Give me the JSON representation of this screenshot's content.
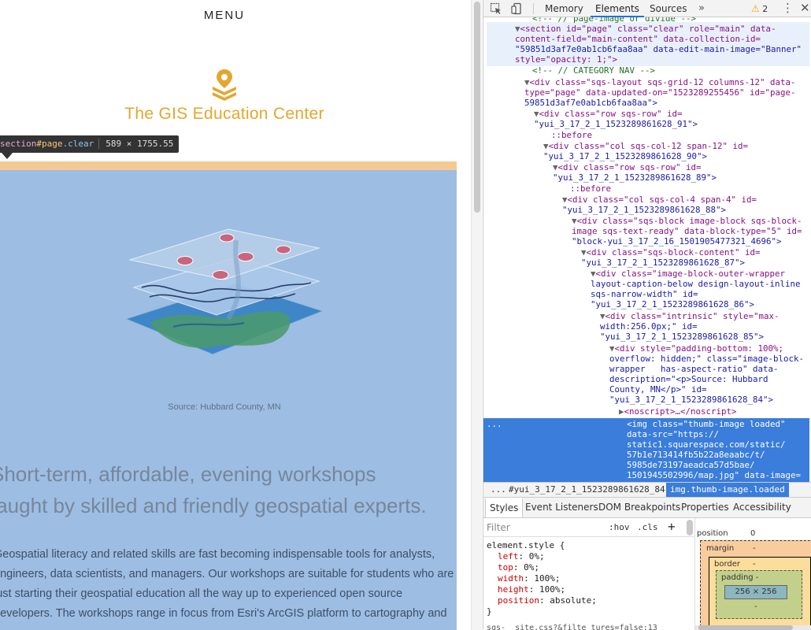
{
  "site": {
    "menu_label": "MENU",
    "title": "The GIS Education Center",
    "caption": "Source: Hubbard County, MN",
    "lead_lines": [
      "Short-term, affordable, evening workshops",
      "taught by skilled and friendly geospatial experts."
    ],
    "body_lines": [
      "Geospatial literacy and related skills are fast becoming indispensable tools for analysts,",
      "engineers, data scientists, and managers. Our workshops are suitable for students who are",
      "just starting their geospatial education all the way up to experienced open source",
      "developers. The workshops range in focus from Esri's ArcGIS platform to cartography and"
    ],
    "brand_color": "#e3a72f",
    "highlight_color": "#9dbde3"
  },
  "inspect_tooltip": {
    "tag": "section",
    "id": "#page",
    "classes": ".clear",
    "dimensions": "589 × 1755.55"
  },
  "devtools": {
    "tabs": [
      "Memory",
      "Elements",
      "Sources"
    ],
    "active_tab": "Elements",
    "more_tabs": "»",
    "warning_count": "2",
    "close": "✕",
    "dom_lines": [
      "<!-- // page-image or divide -->",
      "<section id=\"page\" class=\"clear\" role=\"main\" data-",
      "content-field=\"main-content\" data-collection-id=",
      "\"59851d3af7e0ab1cb6faa8aa\" data-edit-main-image=\"Banner\"",
      "style=\"opacity: 1;\">",
      "<!-- // CATEGORY NAV -->",
      "<div class=\"sqs-layout sqs-grid-12 columns-12\" data-",
      "type=\"page\" data-updated-on=\"1523289255456\" id=\"page-",
      "59851d3af7e0ab1cb6faa8aa\">",
      "<div class=\"row sqs-row\" id=",
      "\"yui_3_17_2_1_1523289861628_91\">",
      "::before",
      "<div class=\"col sqs-col-12 span-12\" id=",
      "\"yui_3_17_2_1_1523289861628_90\">",
      "<div class=\"row sqs-row\" id=",
      "\"yui_3_17_2_1_1523289861628_89\">",
      "::before",
      "<div class=\"col sqs-col-4 span-4\" id=",
      "\"yui_3_17_2_1_1523289861628_88\">",
      "<div class=\"sqs-block image-block sqs-block-",
      "image sqs-text-ready\" data-block-type=\"5\" id=",
      "\"block-yui_3_17_2_16_1501905477321_4696\">",
      "<div class=\"sqs-block-content\" id=",
      "\"yui_3_17_2_1_1523289861628_87\">",
      "<div class=\"image-block-outer-wrapper",
      "layout-caption-below design-layout-inline",
      "sqs-narrow-width\" id=",
      "\"yui_3_17_2_1_1523289861628_86\">",
      "<div class=\"intrinsic\" style=\"max-",
      "width:256.0px;\" id=",
      "\"yui_3_17_2_1_1523289861628_85\">",
      "<div style=\"padding-bottom: 100%;",
      "overflow: hidden;\" class=\"image-block-",
      "wrapper   has-aspect-ratio\" data-",
      "description=\"<p>Source: Hubbard",
      "County, MN</p>\" id=",
      "\"yui_3_17_2_1_1523289861628_84\">",
      "<noscript>…</noscript>",
      "<img class=\"thumb-image loaded\"",
      "data-src=\"https://",
      "static1.squarespace.com/static/",
      "57b1e713414fb5b22a8eaabc/t/",
      "5985de73197aeadca57d5bae/",
      "1501945502996/map.jpg\" data-image="
    ],
    "selected_gutter": "...",
    "breadcrumbs": [
      "...",
      "#yui_3_17_2_1_1523289861628_84",
      "img.thumb-image.loaded"
    ],
    "sub_tabs": [
      "Styles",
      "Event Listeners",
      "DOM Breakpoints",
      "Properties",
      "Accessibility"
    ],
    "active_sub_tab": "Styles",
    "filter_placeholder": "Filter",
    "hov_label": ":hov",
    "cls_label": ".cls",
    "add_rule": "+",
    "element_style_selector": "element.style {",
    "element_style_close": "}",
    "element_style_props": [
      {
        "name": "left",
        "value": "0%;"
      },
      {
        "name": "top",
        "value": "0%;"
      },
      {
        "name": "width",
        "value": "100%;"
      },
      {
        "name": "height",
        "value": "100%;"
      },
      {
        "name": "position",
        "value": "absolute;"
      }
    ],
    "styles_footer": "sqs-_ site.css?&filte tures=false:13",
    "box_model": {
      "position_label": "position",
      "position_value": "0",
      "margin_label": "margin",
      "border_label": "border",
      "padding_label": "padding -",
      "content_size": "256 × 256",
      "dash": "-"
    }
  }
}
